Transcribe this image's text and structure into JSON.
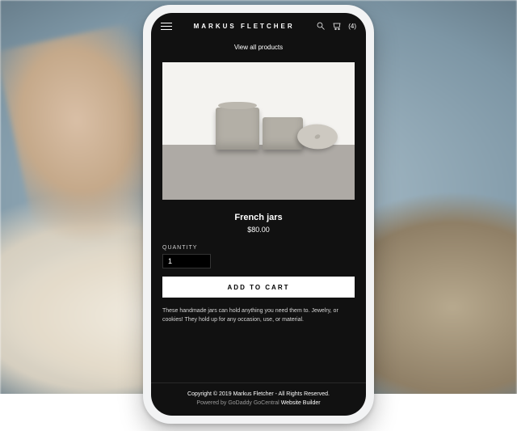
{
  "header": {
    "brand": "MARKUS FLETCHER",
    "cart_count": "(4)"
  },
  "nav": {
    "view_all": "View all products"
  },
  "product": {
    "title": "French jars",
    "price": "$80.00",
    "quantity_label": "QUANTITY",
    "quantity_value": "1",
    "add_to_cart": "ADD TO CART",
    "description": "These handmade jars can hold anything you need them to. Jewelry, or cookies! They hold up for any occasion, use, or material."
  },
  "footer": {
    "copyright": "Copyright © 2019 Markus Fletcher - All Rights Reserved.",
    "powered_prefix": "Powered by GoDaddy GoCentral ",
    "website_builder": "Website Builder"
  }
}
